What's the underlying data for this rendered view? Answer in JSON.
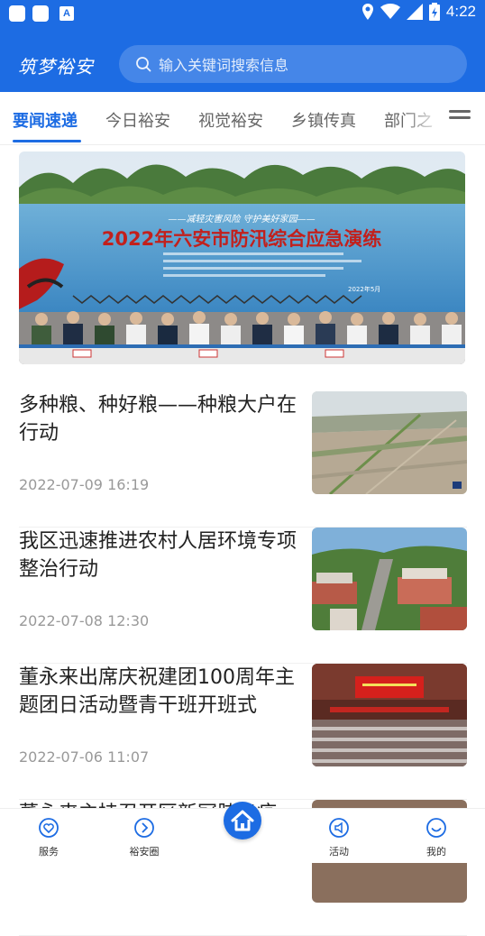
{
  "status": {
    "time": "4:22",
    "notif_letter": "A"
  },
  "header": {
    "brand": "筑梦裕安",
    "search_placeholder": "输入关键词搜索信息"
  },
  "tabs": [
    {
      "label": "要闻速递",
      "active": true
    },
    {
      "label": "今日裕安"
    },
    {
      "label": "视觉裕安"
    },
    {
      "label": "乡镇传真"
    },
    {
      "label": "部门之"
    }
  ],
  "hero": {
    "banner_slogan": "——减轻灾害风险  守护美好家园——",
    "banner_title": "2022年六安市防汛综合应急演练",
    "banner_place_date": "2022年5月"
  },
  "articles": [
    {
      "title": "多种粮、种好粮——种粮大户在行动",
      "date": "2022-07-09 16:19",
      "thumb": "farmland-aerial"
    },
    {
      "title": "我区迅速推进农村人居环境专项整治行动",
      "date": "2022-07-08 12:30",
      "thumb": "village-aerial"
    },
    {
      "title": "董永来出席庆祝建团100周年主题团日活动暨青干班开班式",
      "date": "2022-07-06 11:07",
      "thumb": "meeting-hall"
    },
    {
      "title": "董永来主持召开区新冠肺炎疫",
      "date": "",
      "thumb": "partial"
    }
  ],
  "tabbar": [
    {
      "label": "服务",
      "icon": "heart-icon"
    },
    {
      "label": "裕安圈",
      "icon": "circle-arrow-icon"
    },
    {
      "label": "",
      "icon": "home-icon"
    },
    {
      "label": "活动",
      "icon": "speaker-icon"
    },
    {
      "label": "我的",
      "icon": "smile-icon"
    }
  ],
  "colors": {
    "primary": "#1d6ce3",
    "text": "#222222",
    "muted": "#999999"
  }
}
